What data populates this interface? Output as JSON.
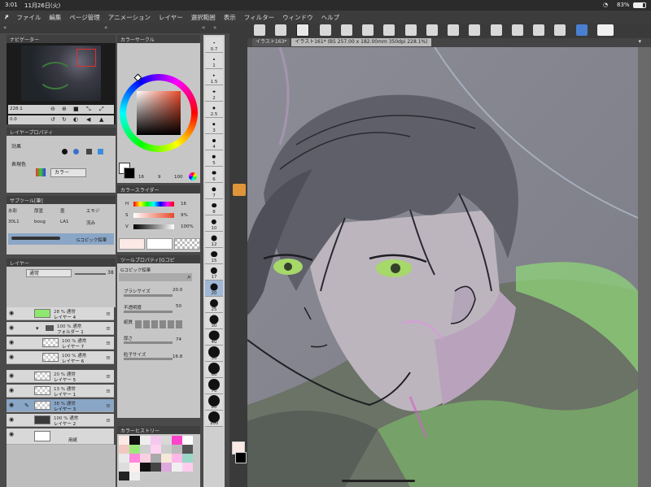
{
  "status": {
    "time": "3:01",
    "date": "11月26日(火)",
    "battery": "83%"
  },
  "menu": [
    "ファイル",
    "編集",
    "ページ管理",
    "アニメーション",
    "レイヤー",
    "選択範囲",
    "表示",
    "フィルター",
    "ウィンドウ",
    "ヘルプ"
  ],
  "navigator": {
    "title": "ナビゲーター",
    "zoom": "228.1",
    "rotate": "0.0"
  },
  "layer_property": {
    "title": "レイヤープロパティ",
    "effect_label": "効果",
    "color_label": "表現色",
    "color_value": "カラー"
  },
  "color_circle": {
    "title": "カラーサークル",
    "h": "16",
    "s": "9",
    "v": "100"
  },
  "color_slider": {
    "title": "カラースライダー",
    "h": "16",
    "s": "9%",
    "v": "100%",
    "h_label": "H",
    "s_label": "S",
    "v_label": "V"
  },
  "sub_tool": {
    "title": "サブツール[筆]",
    "items": [
      [
        "水彩",
        "厚塗",
        "墨",
        "エモジ"
      ],
      [
        "30L1",
        "boug",
        "LA1",
        "流み"
      ]
    ],
    "brush_name": "Gコピック鉛筆"
  },
  "tool_property": {
    "title": "ツールプロパティ[Gコピ",
    "brush_label": "Gコピック鉛筆",
    "brush_size_label": "ブラシサイズ",
    "brush_size": "20.0",
    "opacity_label": "不透明度",
    "opacity": "50",
    "paper_label": "紙質",
    "thickness_label": "厚さ",
    "thickness": "74",
    "grain_size_label": "粒子サイズ",
    "grain_size": "16.8"
  },
  "layers": {
    "title": "レイヤー",
    "blend": "通常",
    "opacity": "38",
    "rows": [
      {
        "pct": "28 % 通常",
        "name": "レイヤー 4",
        "indent": 0
      },
      {
        "pct": "100 % 通常",
        "name": "フォルダー 1",
        "indent": 0
      },
      {
        "pct": "100 % 通常",
        "name": "レイヤー 7",
        "indent": 1
      },
      {
        "pct": "100 % 通常",
        "name": "レイヤー 6",
        "indent": 1
      },
      {
        "pct": "20 % 通常",
        "name": "レイヤー 5",
        "indent": 0
      },
      {
        "pct": "13 % 通常",
        "name": "レイヤー 1",
        "indent": 0
      },
      {
        "pct": "38 % 通常",
        "name": "レイヤー 3",
        "indent": 0
      },
      {
        "pct": "100 % 通常",
        "name": "レイヤー 2",
        "indent": 0
      },
      {
        "pct": "",
        "name": "用紙",
        "indent": 0
      }
    ]
  },
  "color_history": {
    "title": "カラーヒストリー"
  },
  "brush_sizes": [
    "0.7",
    "1",
    "1.5",
    "2",
    "2.5",
    "3",
    "4",
    "5",
    "6",
    "7",
    "8",
    "10",
    "12",
    "15",
    "17",
    "20",
    "25",
    "30",
    "40",
    "50",
    "60",
    "70",
    "80",
    "100"
  ],
  "document_tabs": [
    {
      "label": "イラスト163*"
    },
    {
      "label": "イラスト161* (B5 257.00 x 182.00mm 350dpi 228.1%)"
    }
  ],
  "colors": {
    "accent": "#e84a2a",
    "selected_layer": "#8aa6c6"
  }
}
